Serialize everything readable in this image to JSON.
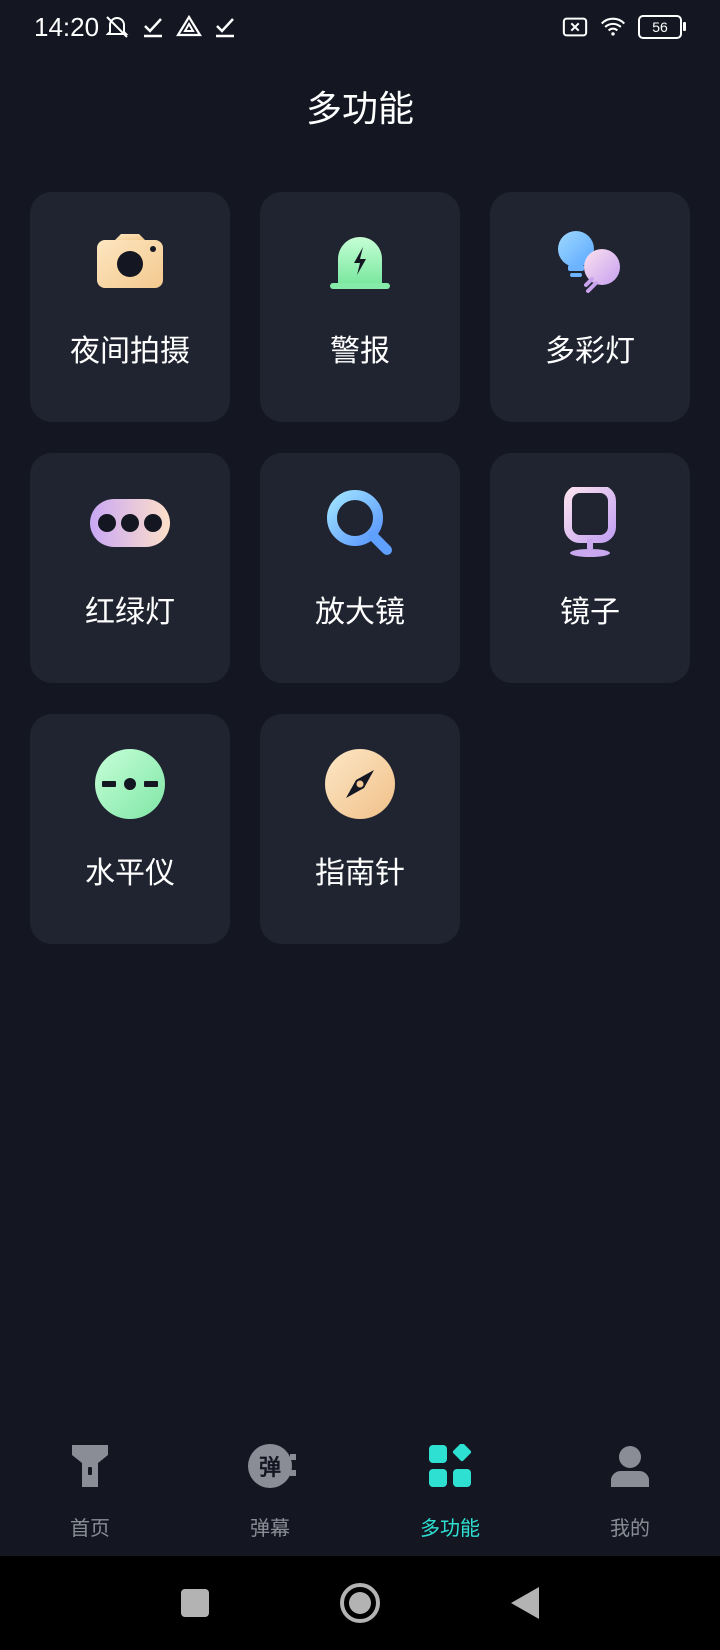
{
  "status_bar": {
    "time": "14:20",
    "left_icons": [
      "bell-mute-icon",
      "check-icon",
      "drive-icon",
      "check-icon"
    ],
    "right_icons": [
      "sim-off-icon",
      "wifi-icon",
      "battery-icon"
    ],
    "battery_level": "56"
  },
  "page": {
    "title": "多功能"
  },
  "tiles": [
    {
      "label": "夜间拍摄",
      "icon": "camera-icon"
    },
    {
      "label": "警报",
      "icon": "alarm-icon"
    },
    {
      "label": "多彩灯",
      "icon": "bulbs-icon"
    },
    {
      "label": "红绿灯",
      "icon": "traffic-light-icon"
    },
    {
      "label": "放大镜",
      "icon": "magnifier-icon"
    },
    {
      "label": "镜子",
      "icon": "mirror-icon"
    },
    {
      "label": "水平仪",
      "icon": "level-icon"
    },
    {
      "label": "指南针",
      "icon": "compass-icon"
    }
  ],
  "bottom_nav": {
    "items": [
      {
        "label": "首页",
        "icon": "flashlight-icon",
        "active": false
      },
      {
        "label": "弹幕",
        "icon": "danmaku-icon",
        "badge_text": "弹",
        "active": false
      },
      {
        "label": "多功能",
        "icon": "grid-icon",
        "active": true
      },
      {
        "label": "我的",
        "icon": "user-icon",
        "active": false
      }
    ]
  },
  "colors": {
    "background": "#141722",
    "tile": "#202430",
    "accent": "#2ee0d2",
    "nav_inactive": "#8a8d96"
  },
  "system_nav": [
    "recents-button",
    "home-button",
    "back-button"
  ]
}
